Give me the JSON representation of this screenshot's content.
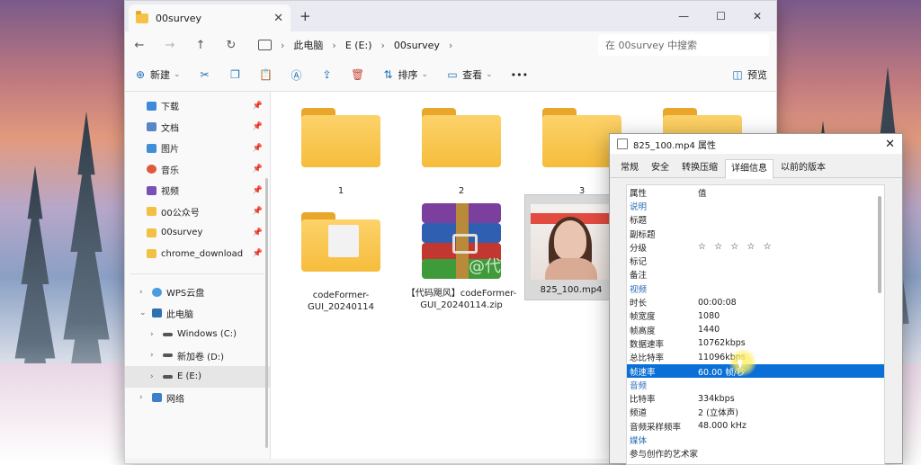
{
  "explorer": {
    "tab_title": "00survey",
    "breadcrumb": [
      "此电脑",
      "E (E:)",
      "00survey"
    ],
    "search_placeholder": "在 00survey 中搜索",
    "toolbar": {
      "new_label": "新建",
      "sort_label": "排序",
      "view_label": "查看",
      "more_label": "•••",
      "preview_label": "预览"
    },
    "nav": {
      "quick_access": [
        {
          "label": "下载",
          "icon": "download-icon",
          "color": "#3d8bd9"
        },
        {
          "label": "文档",
          "icon": "document-icon",
          "color": "#5a86c7"
        },
        {
          "label": "图片",
          "icon": "picture-icon",
          "color": "#3f8fd6"
        },
        {
          "label": "音乐",
          "icon": "music-icon",
          "color": "#e2583e"
        },
        {
          "label": "视频",
          "icon": "video-icon",
          "color": "#7a4fb8"
        },
        {
          "label": "00公众号",
          "icon": "folder-icon",
          "color": "#f2c043"
        },
        {
          "label": "00survey",
          "icon": "folder-icon",
          "color": "#f2c043"
        },
        {
          "label": "chrome_download",
          "icon": "folder-icon",
          "color": "#f2c043"
        }
      ],
      "locations": [
        {
          "label": "WPS云盘",
          "icon": "cloud-icon"
        },
        {
          "label": "此电脑",
          "icon": "computer-icon"
        },
        {
          "label": "Windows (C:)",
          "icon": "drive-icon"
        },
        {
          "label": "新加卷 (D:)",
          "icon": "drive-icon"
        },
        {
          "label": "E (E:)",
          "icon": "drive-icon"
        },
        {
          "label": "网络",
          "icon": "network-icon"
        }
      ]
    },
    "items": [
      {
        "label": "1",
        "type": "folder"
      },
      {
        "label": "2",
        "type": "folder"
      },
      {
        "label": "3",
        "type": "folder"
      },
      {
        "label": "",
        "type": "folder"
      },
      {
        "label": "codeFormer-GUI_20240114",
        "type": "folder"
      },
      {
        "label": "【代码飓风】codeFormer-GUI_20240114.zip",
        "type": "zip"
      },
      {
        "label": "825_100.mp4",
        "type": "video"
      }
    ]
  },
  "properties": {
    "title": "825_100.mp4 属性",
    "tabs": [
      "常规",
      "安全",
      "转换压缩",
      "详细信息",
      "以前的版本"
    ],
    "active_tab": "详细信息",
    "header": {
      "key": "属性",
      "value": "值"
    },
    "rows": [
      {
        "key": "说明",
        "value": "",
        "section": true
      },
      {
        "key": "标题",
        "value": ""
      },
      {
        "key": "副标题",
        "value": ""
      },
      {
        "key": "分级",
        "value": "☆ ☆ ☆ ☆ ☆",
        "stars": true
      },
      {
        "key": "标记",
        "value": ""
      },
      {
        "key": "备注",
        "value": ""
      },
      {
        "key": "视频",
        "value": "",
        "section": true
      },
      {
        "key": "时长",
        "value": "00:00:08"
      },
      {
        "key": "帧宽度",
        "value": "1080"
      },
      {
        "key": "帧高度",
        "value": "1440"
      },
      {
        "key": "数据速率",
        "value": "10762kbps"
      },
      {
        "key": "总比特率",
        "value": "11096kbps"
      },
      {
        "key": "帧速率",
        "value": "60.00 帧/秒",
        "selected": true
      },
      {
        "key": "音频",
        "value": "",
        "section": true
      },
      {
        "key": "比特率",
        "value": "334kbps"
      },
      {
        "key": "频道",
        "value": "2 (立体声)"
      },
      {
        "key": "音频采样频率",
        "value": "48.000 kHz"
      },
      {
        "key": "媒体",
        "value": "",
        "section": true
      },
      {
        "key": "参与创作的艺术家",
        "value": ""
      }
    ]
  },
  "watermark": "@代码"
}
